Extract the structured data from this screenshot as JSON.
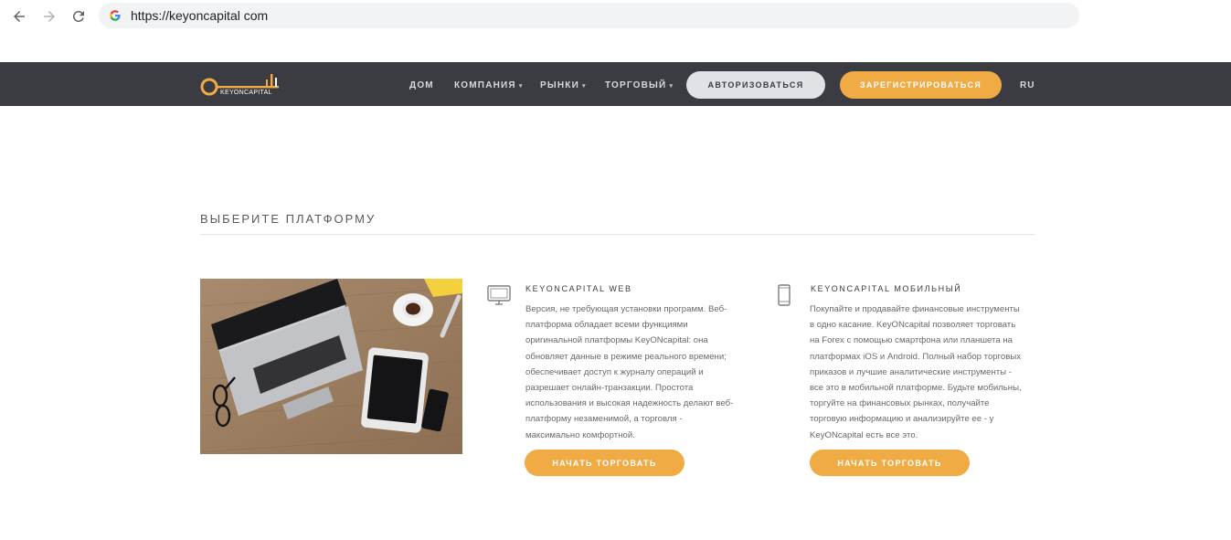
{
  "browser": {
    "url": "https://keyoncapital com",
    "back_icon": "arrow-left-icon",
    "forward_icon": "arrow-right-icon",
    "reload_icon": "reload-icon",
    "site_icon": "google-icon"
  },
  "header": {
    "logo_text": "KEYONCAPITAL",
    "menu": [
      {
        "label": "ДОМ",
        "has_dropdown": false
      },
      {
        "label": "КОМПАНИЯ",
        "has_dropdown": true
      },
      {
        "label": "РЫНКИ",
        "has_dropdown": true
      },
      {
        "label": "ТОРГОВЫЙ",
        "has_dropdown": true
      }
    ],
    "login_label": "АВТОРИЗОВАТЬСЯ",
    "register_label": "ЗАРЕГИСТРИРОВАТЬСЯ",
    "language": "RU",
    "colors": {
      "background": "#3a3c41",
      "accent": "#f0ab45",
      "login_bg": "#e1e2e6"
    }
  },
  "main": {
    "section_title": "ВЫБЕРИТЕ ПЛАТФОРМУ",
    "platforms": [
      {
        "icon": "monitor-icon",
        "title": "KEYONCAPITAL WEB",
        "lines": [
          "Версия, не требующая установки программ. Веб-",
          "платформа обладает всеми функциями",
          "оригинальной платформы KeyONcapital: она",
          "обновляет данные в режиме реального времени;",
          "обеспечивает доступ к журналу операций и",
          "разрешает онлайн-транзакции. Простота",
          "использования и высокая надежность делают веб-",
          "платформу незаменимой, а торговля -",
          "максимально комфортной."
        ],
        "button_label": "НАЧАТЬ ТОРГОВАТЬ"
      },
      {
        "icon": "smartphone-icon",
        "title": "KEYONCAPITAL МОБИЛЬНЫЙ",
        "lines": [
          "Покупайте и продавайте финансовые инструменты",
          "в одно касание. KeyONcapital позволяет торговать",
          "на Forex с помощью смартфона или планшета на",
          "платформах iOS и Android. Полный набор торговых",
          "приказов и лучшие аналитические инструменты -",
          "все это в мобильной платформе. Будьте мобильны,",
          "торгуйте на финансовых рынках, получайте",
          "торговую информацию и анализируйте ее - у",
          "KeyONcapital есть все это."
        ],
        "button_label": "НАЧАТЬ ТОРГОВАТЬ"
      }
    ]
  }
}
